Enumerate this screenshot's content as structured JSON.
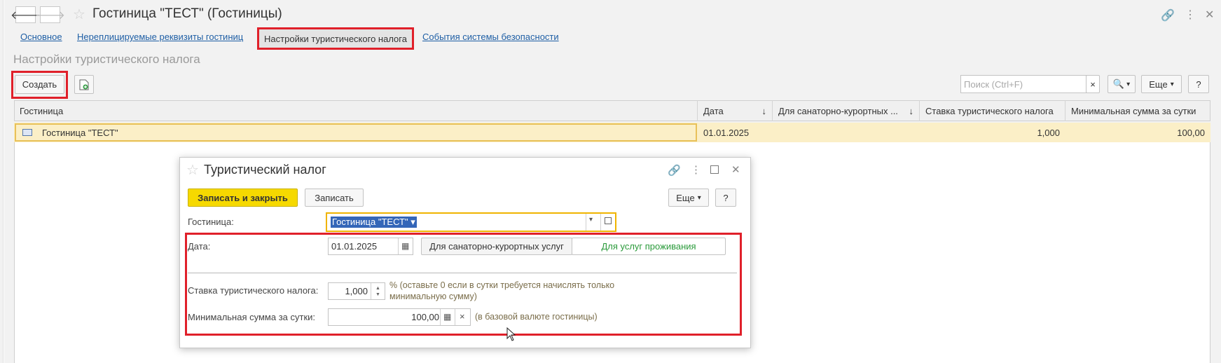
{
  "window": {
    "title": "Гостиница \"ТЕСТ\" (Гостиницы)",
    "back_glyph": "🡐",
    "forward_glyph": "🡒",
    "star_glyph": "☆",
    "link_glyph": "🔗",
    "more_glyph": "⋮",
    "close_glyph": "✕"
  },
  "tabs": [
    {
      "label": "Основное"
    },
    {
      "label": "Нереплицируемые реквизиты гостиниц"
    },
    {
      "label": "Настройки туристического налога",
      "active": true
    },
    {
      "label": "События системы безопасности"
    }
  ],
  "section_title": "Настройки туристического налога",
  "toolbar": {
    "create_label": "Создать",
    "search_placeholder": "Поиск (Ctrl+F)",
    "search_clear": "×",
    "search_glyph": "🔍",
    "dropdown_glyph": "▾",
    "more_label": "Еще",
    "help_label": "?"
  },
  "table": {
    "columns": [
      "Гостиница",
      "Дата",
      "Для санаторно-курортных ...",
      "Ставка туристического налога",
      "Минимальная сумма за сутки"
    ],
    "sort_glyph": "↓",
    "rows": [
      {
        "hotel": "Гостиница \"ТЕСТ\"",
        "date": "01.01.2025",
        "sanatorium": "",
        "rate": "1,000",
        "min_sum": "100,00"
      }
    ]
  },
  "dialog": {
    "title": "Туристический налог",
    "save_close_label": "Записать и закрыть",
    "save_label": "Записать",
    "more_label": "Еще",
    "help_label": "?",
    "hotel_label": "Гостиница:",
    "hotel_value": "Гостиница \"ТЕСТ\" ▾",
    "date_label": "Дата:",
    "date_value": "01.01.2025",
    "toggle_sanatorium": "Для санаторно-курортных услуг",
    "toggle_living": "Для услуг проживания",
    "rate_label": "Ставка туристического налога:",
    "rate_value": "1,000",
    "rate_note_line1": "% (оставьте 0 если в сутки требуется начислять только",
    "rate_note_line2": "минимальную сумму)",
    "min_label": "Минимальная сумма за сутки:",
    "min_value": "100,00",
    "min_note": "(в базовой валюте гостиницы)",
    "clear_glyph": "×",
    "calc_glyph": "▦"
  },
  "colors": {
    "accent_red": "#e0202a",
    "primary_yellow": "#f6d900",
    "link_blue": "#1f5fa5",
    "row_highlight": "#fbefc7",
    "green_text": "#2a9a3a"
  }
}
